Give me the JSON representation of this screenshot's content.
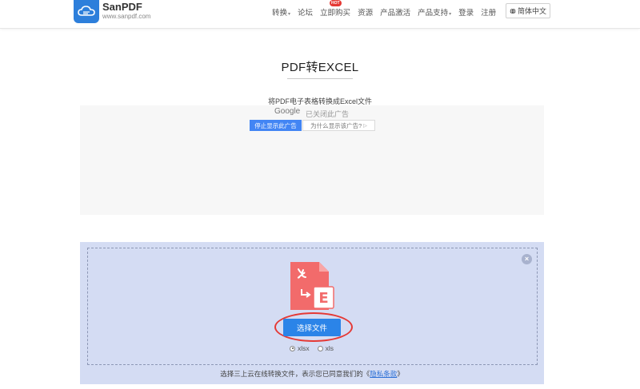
{
  "header": {
    "logo_name": "SanPDF",
    "logo_url": "www.sanpdf.com",
    "nav": [
      {
        "label": "转换",
        "dropdown": true
      },
      {
        "label": "论坛",
        "dropdown": false
      },
      {
        "label": "立即购买",
        "dropdown": false,
        "badge": "HOT"
      },
      {
        "label": "资源",
        "dropdown": false
      },
      {
        "label": "产品激活",
        "dropdown": false
      },
      {
        "label": "产品支持",
        "dropdown": true
      },
      {
        "label": "登录",
        "dropdown": false
      },
      {
        "label": "注册",
        "dropdown": false
      }
    ],
    "language": "简体中文"
  },
  "main": {
    "title": "PDF转EXCEL",
    "subtitle": "将PDF电子表格转换成Excel文件"
  },
  "ad": {
    "google": "Google",
    "closed_text": "已关闭此广告",
    "stop_button": "停止显示此广告",
    "why_button": "为什么显示该广告?"
  },
  "upload": {
    "choose_button": "选择文件",
    "formats": [
      {
        "label": "xlsx",
        "selected": true
      },
      {
        "label": "xls",
        "selected": false
      }
    ],
    "terms_prefix": "选择三上云在线转换文件，表示您已同意我们的《",
    "terms_link": "隐私条款",
    "terms_suffix": "》"
  },
  "colors": {
    "brand_blue": "#2d7fdb",
    "button_blue": "#2b84e8",
    "panel_bg": "#d4dcf3",
    "pdf_red": "#f26b6b",
    "highlight_red": "#e53935"
  }
}
